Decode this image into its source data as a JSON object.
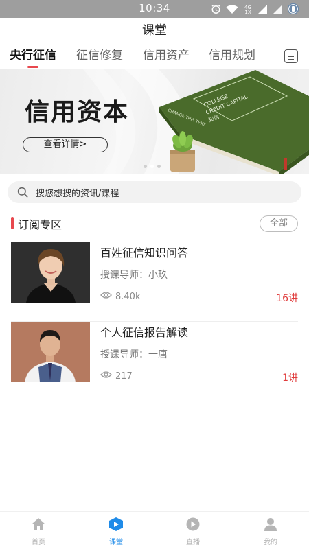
{
  "status_bar": {
    "time": "10:34",
    "network_label": "4G 1X"
  },
  "header": {
    "title": "课堂"
  },
  "tabs": [
    {
      "label": "央行征信",
      "active": true
    },
    {
      "label": "征信修复",
      "active": false
    },
    {
      "label": "信用资产",
      "active": false
    },
    {
      "label": "信用规划",
      "active": false
    }
  ],
  "banner": {
    "headline": "信用资本",
    "button_label": "查看详情>",
    "book_lines": [
      "COLLEGE",
      "CREDIT CAPITAL",
      "知信"
    ],
    "book_spine": "CHANGE THIS TEXT",
    "slide_count": 3,
    "active_slide": 2
  },
  "search": {
    "placeholder": "搜您想搜的资讯/课程"
  },
  "subscription": {
    "title": "订阅专区",
    "all_label": "全部",
    "courses": [
      {
        "title": "百姓征信知识问答",
        "teacher": "授课导师：小玖",
        "views": "8.40k",
        "lessons": "16讲"
      },
      {
        "title": "个人征信报告解读",
        "teacher": "授课导师：一唐",
        "views": "217",
        "lessons": "1讲"
      }
    ]
  },
  "tabbar": [
    {
      "label": "首页",
      "icon": "home-icon",
      "active": false
    },
    {
      "label": "课堂",
      "icon": "classroom-icon",
      "active": true
    },
    {
      "label": "直播",
      "icon": "live-play-icon",
      "active": false
    },
    {
      "label": "我的",
      "icon": "profile-icon",
      "active": false
    }
  ],
  "colors": {
    "accent": "#e8484e",
    "tab_active": "#1f8be8",
    "lesson_count": "#e03b3b",
    "book": "#4a6b2b"
  }
}
